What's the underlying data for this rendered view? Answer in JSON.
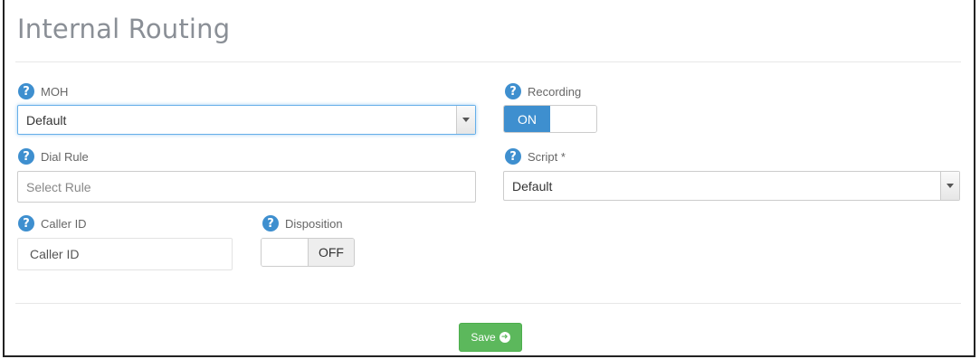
{
  "page": {
    "title": "Internal Routing"
  },
  "moh": {
    "label": "MOH",
    "value": "Default"
  },
  "recording": {
    "label": "Recording",
    "state": "ON"
  },
  "dial_rule": {
    "label": "Dial Rule",
    "placeholder": "Select Rule"
  },
  "script": {
    "label": "Script *",
    "value": "Default"
  },
  "caller_id": {
    "label": "Caller ID",
    "placeholder": "Caller ID"
  },
  "disposition": {
    "label": "Disposition",
    "state": "OFF"
  },
  "actions": {
    "save_label": "Save"
  },
  "icons": {
    "help": "question-circle-icon",
    "save": "arrow-circle-right-icon"
  },
  "colors": {
    "accent": "#3e8fcf",
    "save": "#5cb85c"
  }
}
